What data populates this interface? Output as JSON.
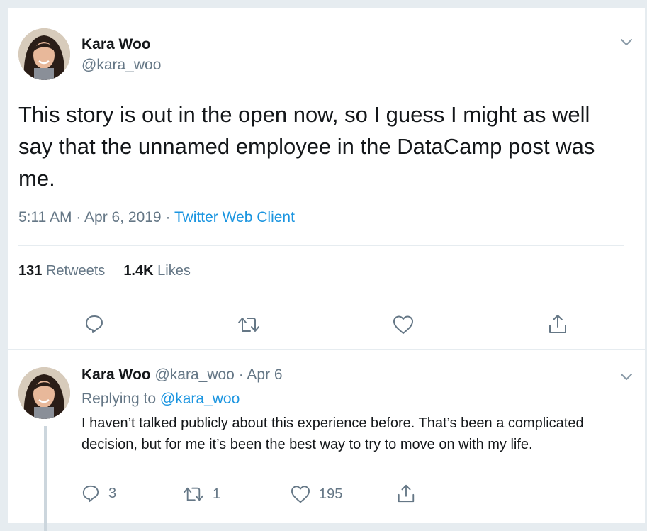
{
  "tweet": {
    "author_name": "Kara Woo",
    "author_handle": "@kara_woo",
    "text": "This story is out in the open now, so I guess I might as well say that the unnamed employee in the DataCamp post was me.",
    "time": "5:11 AM",
    "date": "Apr 6, 2019",
    "separator": "·",
    "client": "Twitter Web Client",
    "retweets_count": "131",
    "retweets_label": "Retweets",
    "likes_count": "1.4K",
    "likes_label": "Likes"
  },
  "reply": {
    "author_name": "Kara Woo",
    "author_handle": "@kara_woo",
    "separator": "·",
    "date": "Apr 6",
    "replying_label": "Replying to",
    "replying_handle": "@kara_woo",
    "text": "I haven’t talked publicly about this experience before. That’s been a complicated decision, but for me it’s been the best way to try to move on with my life.",
    "reply_count": "3",
    "retweet_count": "1",
    "like_count": "195"
  },
  "icons": {
    "chevron": "chevron-down-icon",
    "reply": "reply-icon",
    "retweet": "retweet-icon",
    "like": "heart-icon",
    "share": "share-icon"
  },
  "colors": {
    "link": "#1b95e0",
    "secondary_text": "#657786",
    "primary_text": "#14171a",
    "icon": "#657786",
    "background": "#e6ecf0"
  }
}
